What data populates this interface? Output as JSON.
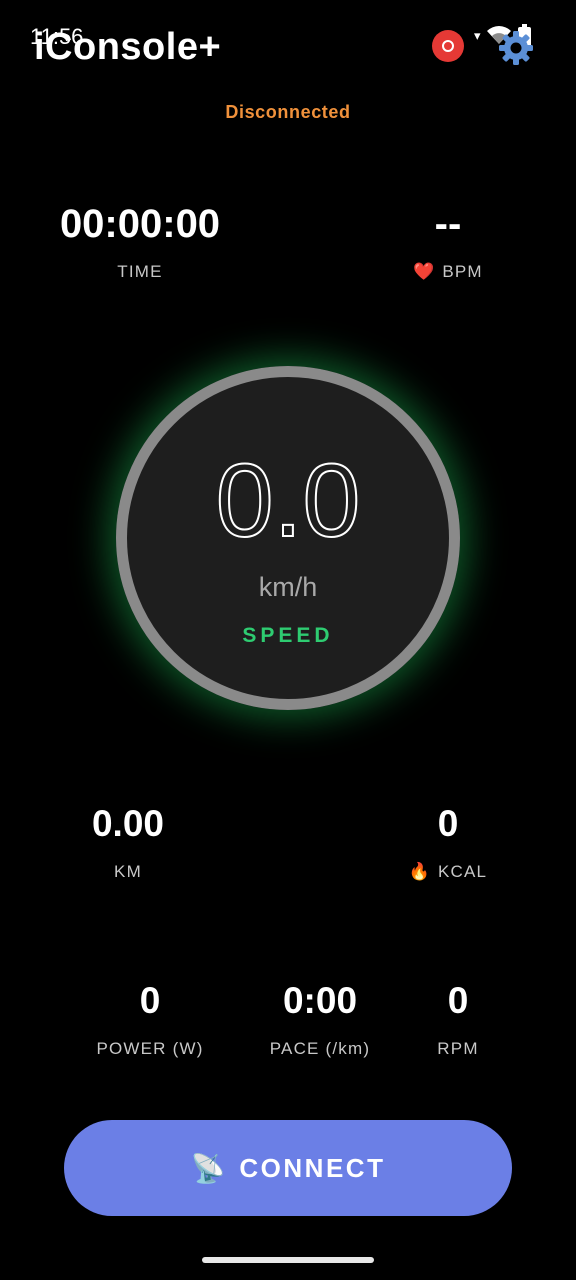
{
  "status_bar": {
    "time": "11:56",
    "icons": [
      "record-icon",
      "signal-arrow-icon",
      "wifi-icon",
      "battery-icon"
    ]
  },
  "header": {
    "title": "iConsole+",
    "settings_icon": "gear-icon"
  },
  "connection": {
    "status": "Disconnected",
    "color": "#f0913b"
  },
  "metrics": {
    "time": {
      "value": "00:00:00",
      "label": "TIME"
    },
    "bpm": {
      "value": "--",
      "label": "BPM",
      "emoji": "❤️"
    },
    "km": {
      "value": "0.00",
      "label": "KM"
    },
    "kcal": {
      "value": "0",
      "label": "KCAL",
      "emoji": "🔥"
    },
    "power": {
      "value": "0",
      "label": "POWER (W)"
    },
    "pace": {
      "value": "0:00",
      "label": "PACE (/km)"
    },
    "rpm": {
      "value": "0",
      "label": "RPM"
    }
  },
  "speed": {
    "value": "0.0",
    "unit": "km/h",
    "label": "SPEED",
    "accent_color": "#2ecc71",
    "ring_color": "#8a8a8a"
  },
  "connect_button": {
    "label": "CONNECT",
    "icon": "📡",
    "color": "#6b7fe6"
  }
}
